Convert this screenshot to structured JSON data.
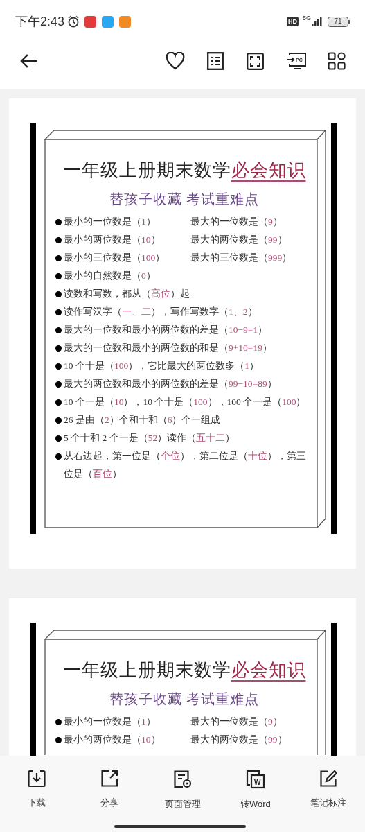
{
  "status_bar": {
    "time": "下午2:43",
    "hd": "HD",
    "network": "5G",
    "battery": "71"
  },
  "toolbar": {
    "cast_label": "PC"
  },
  "pages": [
    {
      "title": "一年级上册期末数学**必会知识**",
      "subtitle": "替孩子收藏 考试重难点",
      "items": [
        {
          "cells": [
            "最小的一位数是（*1*）",
            "最大的一位数是（*9*）"
          ]
        },
        {
          "cells": [
            "最小的两位数是（*10*）",
            "最大的两位数是（*99*）"
          ]
        },
        {
          "cells": [
            "最小的三位数是（*100*）",
            "最大的三位数是（*999*）"
          ]
        },
        {
          "cells": [
            "最小的自然数是（*0*）"
          ]
        },
        {
          "cells": [
            "读数和写数，都从（*高位*）起"
          ]
        },
        {
          "cells": [
            "读作写汉字（*一、二*），写作写数字（*1、2*）"
          ]
        },
        {
          "cells": [
            "最大的一位数和最小的两位数的差是（*10−9=1*）"
          ]
        },
        {
          "cells": [
            "最大的一位数和最小的两位数的和是（*9+10=19*）"
          ]
        },
        {
          "cells": [
            "10 个十是（*100*），它比最大的两位数多（*1*）"
          ]
        },
        {
          "cells": [
            "最大的两位数和最小的两位数的差是（*99−10=89*）"
          ]
        },
        {
          "cells": [
            "10 个一是（*10*），10 个十是（*100*），100 个一是（*100*）"
          ]
        },
        {
          "cells": [
            "26 是由（*2*）个和十和（*6*）个一组成"
          ]
        },
        {
          "cells": [
            "5 个十和 2 个一是（*52*）读作（*五十二*）"
          ]
        },
        {
          "cells": [
            "从右边起，第一位是（*个位*），第二位是（*十位*），第三位是（*百位*）"
          ]
        }
      ]
    },
    {
      "title": "一年级上册期末数学**必会知识**",
      "subtitle": "替孩子收藏 考试重难点",
      "items": [
        {
          "cells": [
            "最小的一位数是（*1*）",
            "最大的一位数是（*9*）"
          ]
        },
        {
          "cells": [
            "最小的两位数是（*10*）",
            "最大的两位数是（*99*）"
          ]
        }
      ]
    }
  ],
  "actions": [
    {
      "kind": "download",
      "label": "下载"
    },
    {
      "kind": "share",
      "label": "分享"
    },
    {
      "kind": "pages",
      "label": "页面管理"
    },
    {
      "kind": "word",
      "label": "转Word",
      "icon_text": "W"
    },
    {
      "kind": "note",
      "label": "笔记标注"
    }
  ]
}
